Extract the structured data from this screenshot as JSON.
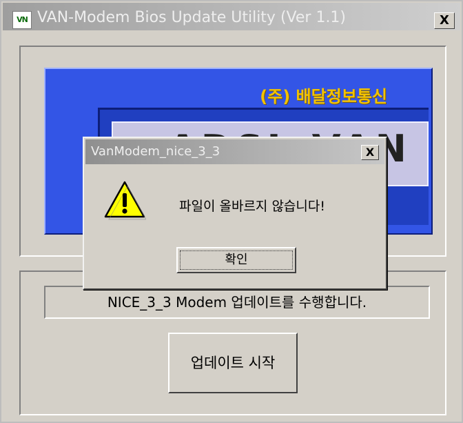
{
  "window": {
    "title": "VAN-Modem Bios Update Utility (Ver 1.1)",
    "icon": "app-icon",
    "close_label": "X"
  },
  "banner": {
    "company": "(주) 배달정보통신",
    "logo_text": "ADSL VAN",
    "colors": {
      "blue": "#3355e6",
      "gold": "#f2c200"
    }
  },
  "status": {
    "text": "NICE_3_3 Modem 업데이트를 수행합니다."
  },
  "buttons": {
    "start": "업데이트 시작"
  },
  "dialog": {
    "title": "VanModem_nice_3_3",
    "close_label": "X",
    "icon": "warning-icon",
    "message": "파일이 올바르지 않습니다!",
    "ok": "확인"
  }
}
